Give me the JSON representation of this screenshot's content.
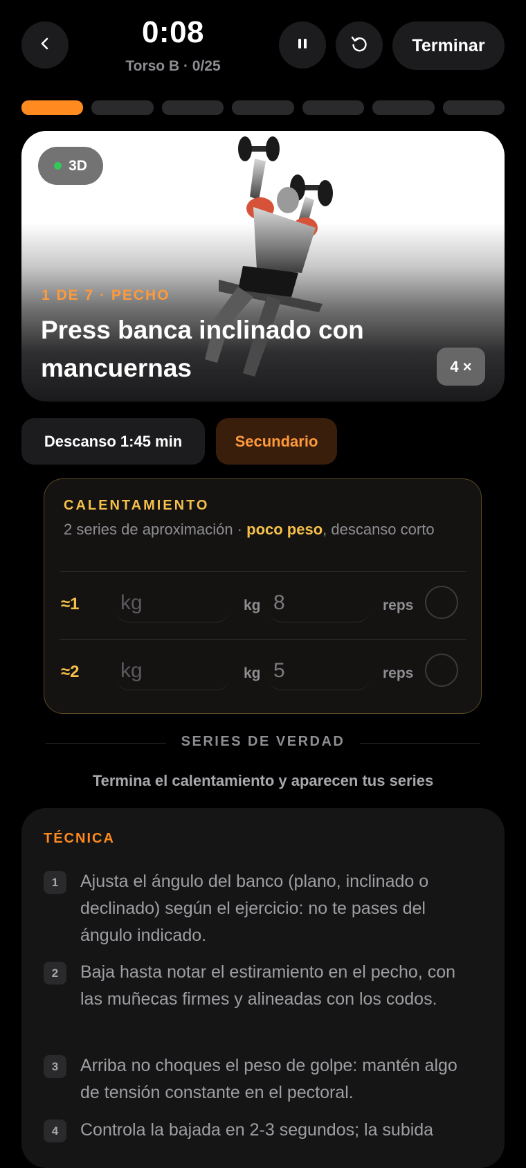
{
  "header": {
    "back_icon": "chevron-left-icon",
    "timer": "0:08",
    "subtitle": "Torso B · 0/25",
    "pause_icon": "pause-icon",
    "restart_icon": "restart-icon",
    "finish_label": "Terminar"
  },
  "progress": {
    "total_segments": 7,
    "active_segment": 1,
    "active_color": "#ff8a1f"
  },
  "exercise": {
    "badge_label": "3D",
    "badge_dot_color": "#34c759",
    "meta": "1 DE 7 · PECHO",
    "title": "Press banca inclinado con mancuernas",
    "sets_badge": "4 ×",
    "rest_label": "Descanso 1:45 min",
    "role_label": "Secundario"
  },
  "warmup": {
    "title": "CALENTAMIENTO",
    "desc_before": "2 series de aproximación · ",
    "desc_highlight": "poco peso",
    "desc_after": ", descanso corto",
    "rows": [
      {
        "index": "≈1",
        "kg_placeholder": "kg",
        "kg_unit": "kg",
        "reps_value": "8",
        "reps_unit": "reps"
      },
      {
        "index": "≈2",
        "kg_placeholder": "kg",
        "kg_unit": "kg",
        "reps_value": "5",
        "reps_unit": "reps"
      }
    ]
  },
  "real_sets": {
    "title": "SERIES DE VERDAD",
    "hint": "Termina el calentamiento y aparecen tus series"
  },
  "technique": {
    "title": "TÉCNICA",
    "steps": [
      {
        "num": "1",
        "text": "Ajusta el ángulo del banco (plano, inclinado o declinado) según el ejercicio: no te pases del ángulo indicado."
      },
      {
        "num": "2",
        "text": "Baja hasta notar el estiramiento en el pecho, con las muñecas firmes y alineadas con los codos."
      },
      {
        "num": "3",
        "text": "Arriba no choques el peso de golpe: mantén algo de tensión constante en el pectoral."
      },
      {
        "num": "4",
        "text": "Controla la bajada en 2-3 segundos; la subida"
      }
    ]
  }
}
